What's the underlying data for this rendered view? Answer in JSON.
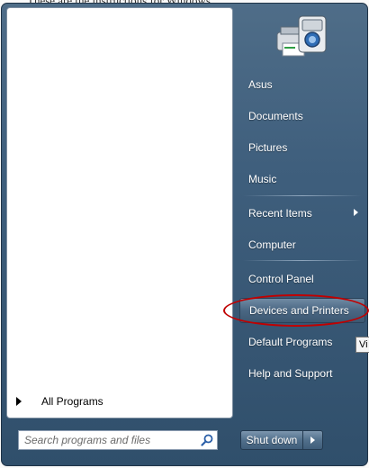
{
  "background": {
    "doc_text": "These are the instructions for Windows"
  },
  "left_pane": {
    "all_programs_label": "All Programs",
    "search_placeholder": "Search programs and files"
  },
  "right_pane": {
    "icon": "devices-and-printers-icon",
    "items": [
      {
        "label": "Asus"
      },
      {
        "label": "Documents"
      },
      {
        "label": "Pictures"
      },
      {
        "label": "Music"
      },
      {
        "label": "Recent Items",
        "has_submenu": true
      },
      {
        "label": "Computer"
      },
      {
        "label": "Control Panel"
      },
      {
        "label": "Devices and Printers",
        "highlighted": true,
        "annotated": true
      },
      {
        "label": "Default Programs"
      },
      {
        "label": "Help and Support"
      }
    ]
  },
  "tooltip": {
    "text": "Vi"
  },
  "shutdown": {
    "label": "Shut down"
  },
  "colors": {
    "menu_background": "#3f5f7d",
    "annotation": "#c00000",
    "left_pane": "#ffffff"
  }
}
